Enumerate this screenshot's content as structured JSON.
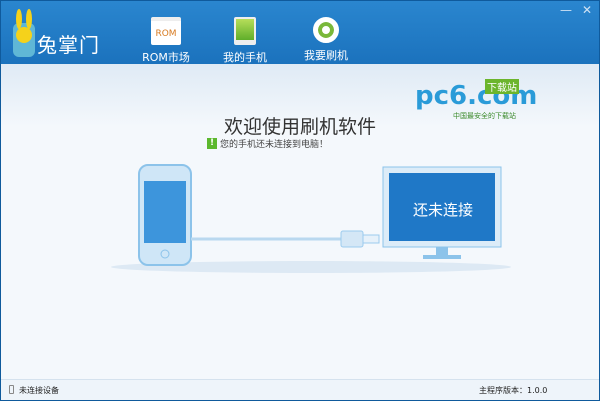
{
  "app": {
    "logo_text": "兔掌门"
  },
  "nav": [
    {
      "label": "ROM市场",
      "icon_text": "ROM"
    },
    {
      "label": "我的手机"
    },
    {
      "label": "我要刷机"
    }
  ],
  "window": {
    "minimize": "—",
    "close": "✕"
  },
  "watermark": {
    "brand": "pc6.com",
    "tag": "下载站",
    "slogan": "中国最安全的下载站"
  },
  "main": {
    "title": "欢迎使用刷机软件",
    "warning_icon": "!",
    "warning": "您的手机还未连接到电脑！",
    "screen_text": "还未连接"
  },
  "status": {
    "device": "未连接设备",
    "version": "主程序版本：1.0.0"
  },
  "colors": {
    "header": "#1b72bd",
    "accent": "#5cb82e"
  }
}
